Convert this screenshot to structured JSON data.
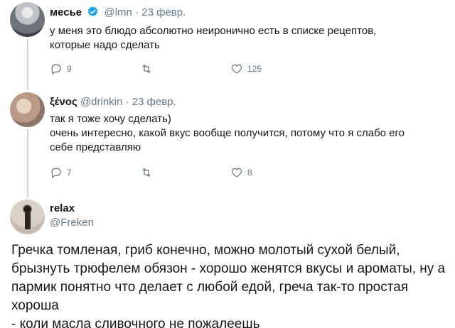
{
  "tweets": [
    {
      "name": "месье",
      "handle": "@lmn",
      "separator": "·",
      "date": "23 февр.",
      "verified": true,
      "text_lines": [
        "у меня это блюдо абсолютно неиронично есть в списке рецептов,",
        "которые надо сделать"
      ],
      "replies": "9",
      "retweets": "",
      "likes": "125"
    },
    {
      "name": "ξένος",
      "handle": "@drinkin",
      "separator": "·",
      "date": "23 февр.",
      "verified": false,
      "text_lines": [
        "так я тоже хочу сделать)",
        "очень интересно, какой вкус вообще получится, потому что я слабо его",
        "себе представляю"
      ],
      "replies": "7",
      "retweets": "",
      "likes": "8"
    }
  ],
  "main_tweet": {
    "name": "relax",
    "handle": "@Freken",
    "text_lines": [
      "Гречка томленая, гриб конечно, можно молотый сухой белый,",
      "брызнуть трюфелем обязон - хорошо женятся вкусы и ароматы, ну а",
      "пармик понятно что делает с любой едой, греча так-то простая хороша",
      "- коли масла сливочного не пожалеешь"
    ]
  },
  "colors": {
    "text": "#14171a",
    "secondary": "#657786",
    "verified": "#1da1f2",
    "thread_line": "#ccd6dd"
  },
  "icons": [
    "reply-icon",
    "retweet-icon",
    "like-icon",
    "verified-icon"
  ]
}
